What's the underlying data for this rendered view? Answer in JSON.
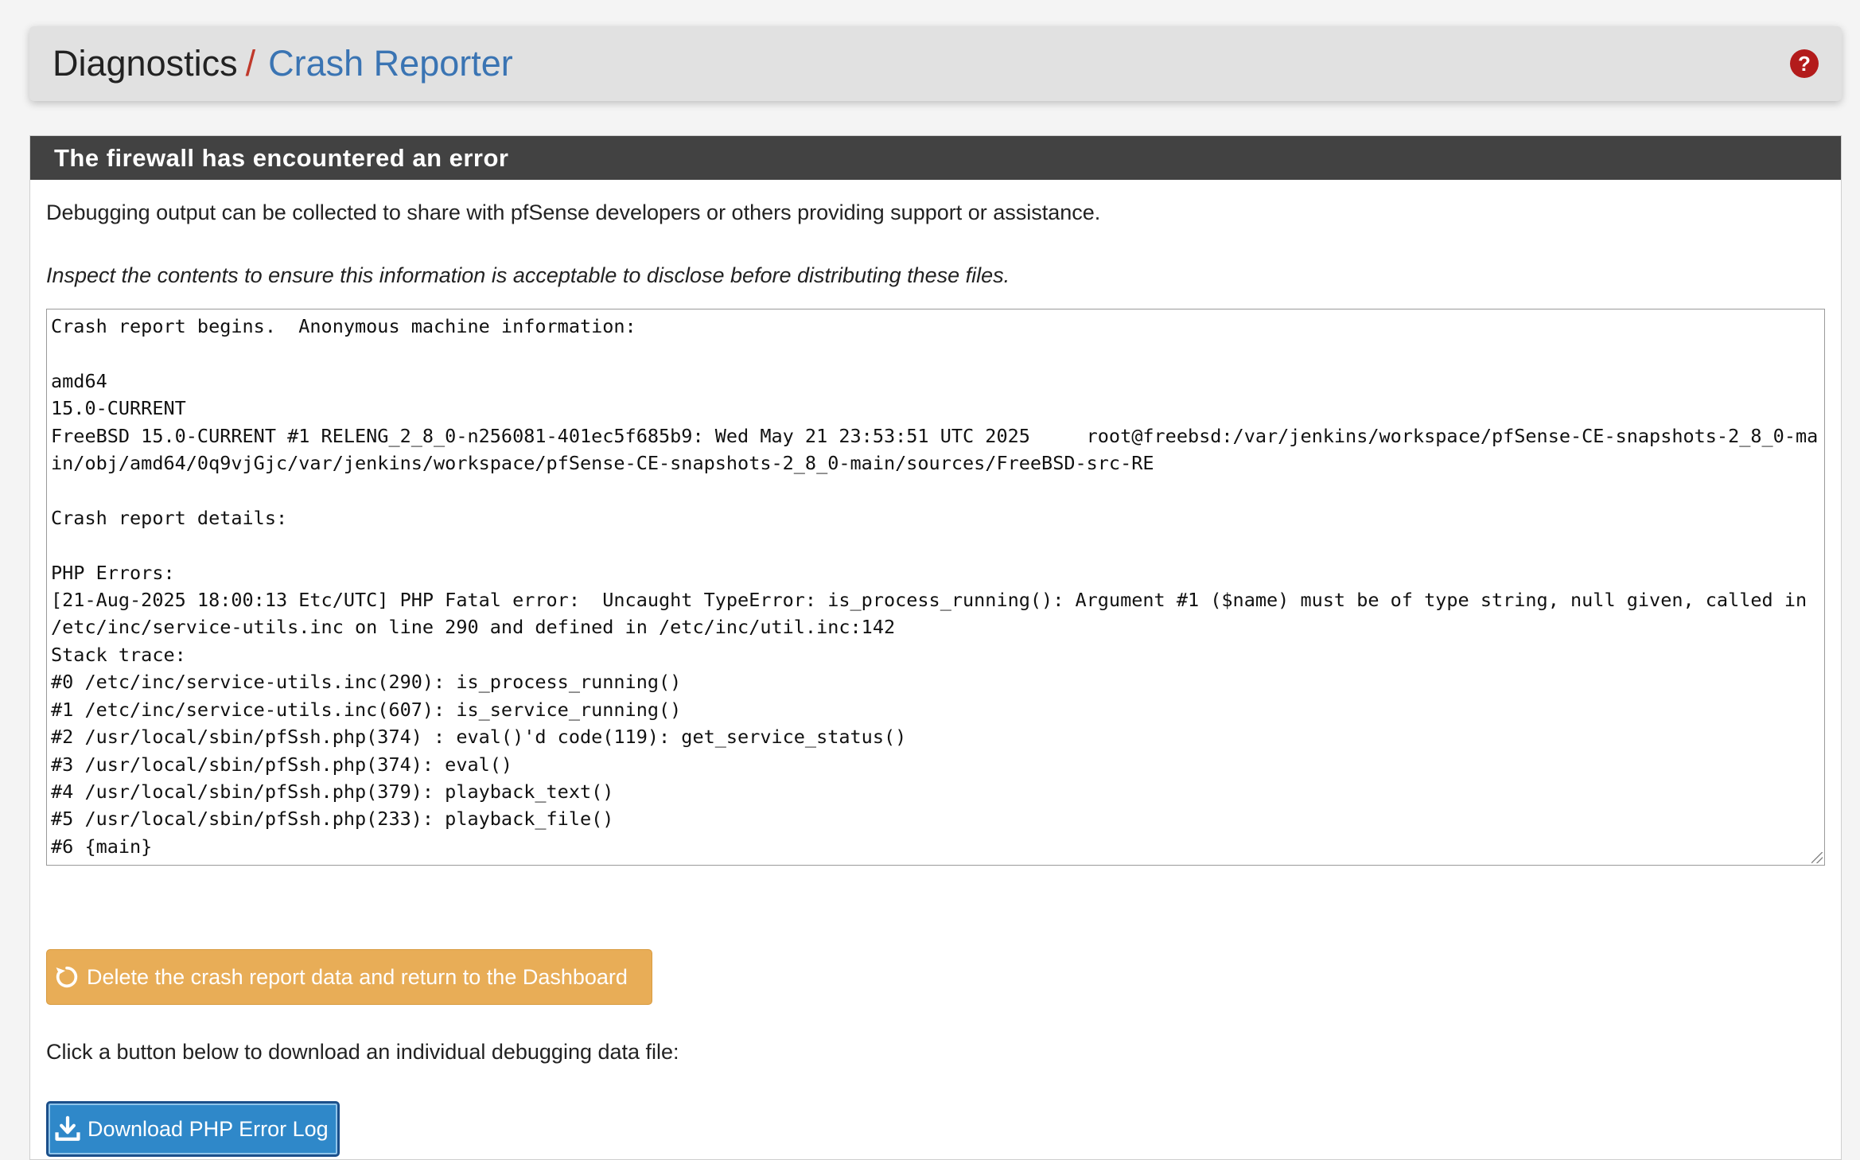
{
  "breadcrumb": {
    "root": "Diagnostics",
    "separator": "/",
    "current": "Crash Reporter"
  },
  "help": {
    "icon": "help-icon",
    "glyph": "?"
  },
  "panel": {
    "title": "The firewall has encountered an error",
    "intro": "Debugging output can be collected to share with pfSense developers or others providing support or assistance.",
    "warning": "Inspect the contents to ensure this information is acceptable to disclose before distributing these files.",
    "report": "Crash report begins.  Anonymous machine information:\n\namd64\n15.0-CURRENT\nFreeBSD 15.0-CURRENT #1 RELENG_2_8_0-n256081-401ec5f685b9: Wed May 21 23:53:51 UTC 2025     root@freebsd:/var/jenkins/workspace/pfSense-CE-snapshots-2_8_0-main/obj/amd64/0q9vjGjc/var/jenkins/workspace/pfSense-CE-snapshots-2_8_0-main/sources/FreeBSD-src-RE\n\nCrash report details:\n\nPHP Errors:\n[21-Aug-2025 18:00:13 Etc/UTC] PHP Fatal error:  Uncaught TypeError: is_process_running(): Argument #1 ($name) must be of type string, null given, called in /etc/inc/service-utils.inc on line 290 and defined in /etc/inc/util.inc:142\nStack trace:\n#0 /etc/inc/service-utils.inc(290): is_process_running()\n#1 /etc/inc/service-utils.inc(607): is_service_running()\n#2 /usr/local/sbin/pfSsh.php(374) : eval()'d code(119): get_service_status()\n#3 /usr/local/sbin/pfSsh.php(374): eval()\n#4 /usr/local/sbin/pfSsh.php(379): playback_text()\n#5 /usr/local/sbin/pfSsh.php(233): playback_file()\n#6 {main}",
    "delete_button": "Delete the crash report data and return to the Dashboard",
    "download_hint": "Click a button below to download an individual debugging data file:",
    "download_button": "Download PHP Error Log"
  },
  "colors": {
    "header_bg": "#e1e1e1",
    "panel_heading_bg": "#424242",
    "breadcrumb_link": "#3a74b3",
    "separator": "#c0392b",
    "help_icon": "#b31b1b",
    "warning_button": "#e8ad57",
    "primary_button": "#2f88c9"
  },
  "icons": {
    "delete": "undo-icon",
    "download": "download-icon"
  }
}
